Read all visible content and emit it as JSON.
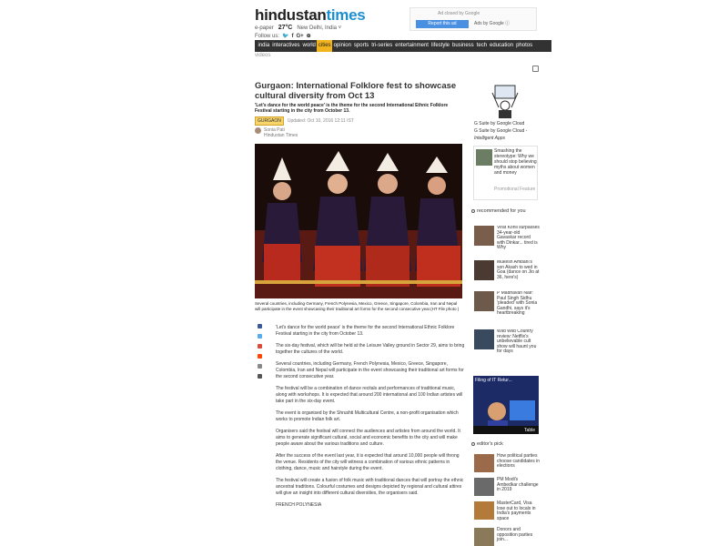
{
  "header": {
    "logo_part1": "hindustan",
    "logo_part2": "times",
    "epaper": "e-paper",
    "temperature": "27°C",
    "city": "New Delhi, India ˅",
    "follow_label": "Follow us:",
    "social": [
      "🐦",
      "f",
      "G+",
      "⊕"
    ]
  },
  "ad_top": {
    "label": "Ad closed by Google",
    "report": "Report this ad",
    "ads_by": "Ads by Google ⓘ"
  },
  "nav": {
    "items": [
      "india",
      "interactives",
      "world",
      "cities",
      "opinion",
      "sports",
      "tri-series",
      "entertainment",
      "lifestyle",
      "business",
      "tech",
      "education",
      "photos"
    ],
    "active": "cities",
    "sub": "videos"
  },
  "article": {
    "title": "Gurgaon: International Folklore fest to showcase cultural diversity from Oct 13",
    "summary": "'Let's dance for the world peace' is the theme for the second International Ethnic Folklore Festival starting in the city from October 13.",
    "tag": "GURGAON",
    "updated": "Updated: Oct 10, 2016 12:11 IST",
    "author_name": "Sonia Pati",
    "author_org": "Hindustan Times",
    "caption": "Several countries, including Germany, French Polynesia, Mexico, Greece, Singapore, Colombia, Iran and Nepal will participate in the event showcasing their traditional art forms for the second consecutive year.(HT File photo )",
    "paragraphs": [
      "'Let's dance for the world peace' is the theme for the second International Ethnic Folklore Festival starting in the city from October 13.",
      "The six-day festival, which will be held at the Leisure Valley ground in Sector 29, aims to bring together the cultures of the world.",
      "Several countries, including Germany, French Polynesia, Mexico, Greece, Singapore, Colombia, Iran and Nepal will participate in the event showcasing their traditional art forms for the second consecutive year.",
      "The festival will be a combination of dance recitals and performances of traditional music, along with workshops. It is expected that around 200 international and 100 Indian artistes will take part in the six-day event.",
      "The event is organised by the Shrushti Multicultural Centre, a non-profit organisation which works to promote Indian folk art.",
      "Organisers said the festival will connect the audiences and artistes from around the world. It aims to generate significant cultural, social and economic benefits to the city and will make people aware about the various traditions and culture.",
      "After the success of the event last year, it is expected that around 10,000 people will throng the venue. Residents of the city will witness a combination of various ethnic patterns in clothing, dance, music and hairstyle during the event.",
      "The festival will create a fusion of folk music with traditional dances that will portray the ethnic ancestral traditions. Colourful costumes and designs depicted by regional and cultural attires will give an insight into different cultural diversities, the organisers said.",
      "FRENCH POLYNESIA"
    ]
  },
  "sidebar": {
    "gsuite1": "G Suite by Google Cloud",
    "gsuite2": "G Suite by Google Cloud -",
    "gsuite3": "Intelligent Apps",
    "promo_text": "Smashing the stereotype: Why we should stop believing myths about women and money",
    "promo_label": "Promotional Feature",
    "recommended_label": "recommended for you",
    "recommended": [
      "Virat Kohli surpasses 34-year-old Gavaskar record with Dinkar... tired is Why",
      "Mukesh Ambani's son Akash to wed in Goa (dance on Jio at 36, here's)",
      "P Madhavan Nair: Paul Singh Sidhu 'pleaded' with Sonia Gandhi, says it's heartbreaking",
      "Wild Wild Country review: Netflix's unbelievable cult show will haunt you for days"
    ],
    "video_title": "Filing of IT Retur...",
    "video_brand": "Table",
    "editors_pick_label": "editor's pick",
    "editors_pick": [
      "How political parties choose candidates in elections",
      "PM Modi's Ambedkar challenge in 2019",
      "MasterCard, Visa lose out to locals in India's payments space",
      "Donors and opposition parties join..."
    ]
  }
}
